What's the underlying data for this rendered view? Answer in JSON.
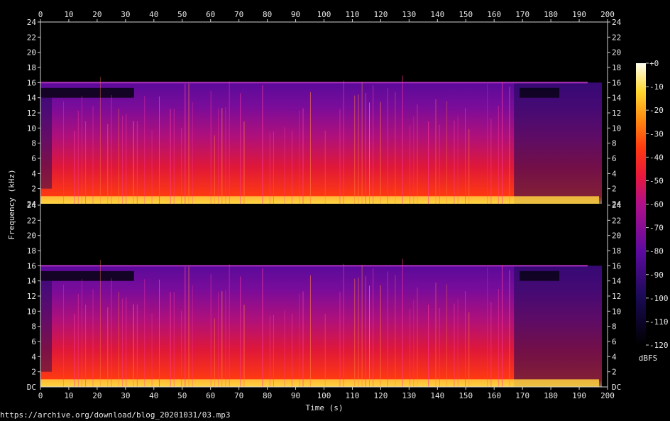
{
  "chart_data": {
    "type": "heatmap",
    "title": "",
    "xlabel": "Time (s)",
    "ylabel": "Frequency (kHz)",
    "xlim": [
      0,
      200
    ],
    "ylim": [
      0,
      24
    ],
    "x_ticks": [
      0,
      10,
      20,
      30,
      40,
      50,
      60,
      70,
      80,
      90,
      100,
      110,
      120,
      130,
      140,
      150,
      160,
      170,
      180,
      190,
      200
    ],
    "y_ticks": [
      2,
      4,
      6,
      8,
      10,
      12,
      14,
      16,
      18,
      20,
      22,
      24
    ],
    "y_tick_labels": [
      "2",
      "4",
      "6",
      "8",
      "10",
      "12",
      "14",
      "16",
      "18",
      "20",
      "22",
      "24"
    ],
    "y_bottom_label_top_panel": "24",
    "y_bottom_label_bottom_panel": "DC",
    "channels": 2,
    "content_end_s": 198,
    "lowpass_cutoff_khz": 16,
    "colorbar": {
      "label": "dBFS",
      "ticks": [
        "+0",
        "-10",
        "-20",
        "-30",
        "-40",
        "-50",
        "-60",
        "-70",
        "-80",
        "-90",
        "-100",
        "-110",
        "-120"
      ],
      "range": [
        -120,
        0
      ]
    },
    "grid": false
  },
  "source_url": "https://archive.org/download/blog_20201031/03.mp3"
}
